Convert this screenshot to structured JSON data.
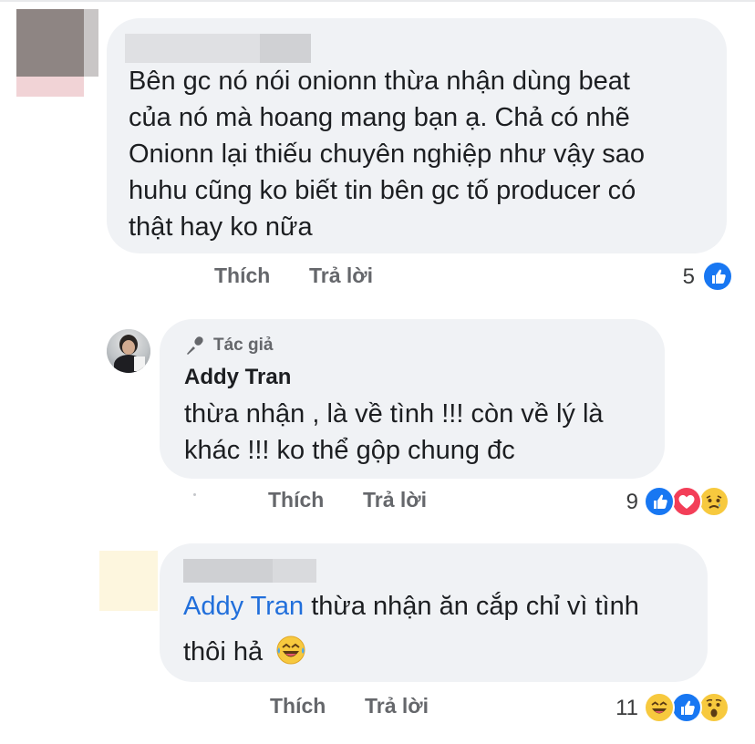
{
  "comments": [
    {
      "text_lines": [
        "Bên gc nó nói onionn thừa nhận dùng beat",
        "của nó mà hoang mang bạn ạ. Chả có nhẽ",
        "Onionn lại thiếu chuyên nghiệp như vậy sao",
        "huhu cũng ko biết tin bên gc tố producer có",
        "thật hay ko nữa"
      ],
      "like_label": "Thích",
      "reply_label": "Trả lời",
      "reaction_count": "5",
      "reactions": [
        "like"
      ]
    },
    {
      "badge_label": "Tác giả",
      "author": "Addy Tran",
      "text_lines": [
        "thừa nhận , là về tình !!! còn về lý là",
        "khác !!! ko thể gộp chung đc"
      ],
      "like_label": "Thích",
      "reply_label": "Trả lời",
      "reaction_count": "9",
      "reactions": [
        "like",
        "love",
        "sad"
      ]
    },
    {
      "mention": "Addy Tran",
      "text_line1_rest": " thừa nhận ăn cắp chỉ vì tình",
      "text_line2": "thôi hả",
      "emoji": "laughing-with-tears",
      "like_label": "Thích",
      "reply_label": "Trả lời",
      "reaction_count": "11",
      "reactions": [
        "haha",
        "like",
        "wow"
      ]
    }
  ],
  "colors": {
    "bubble": "#f0f2f5",
    "text": "#1c1e21",
    "action": "#65676b",
    "mention": "#216fdb",
    "like": "#1877f2",
    "love": "#f33e58",
    "emoji_yellow": "#f7c93e"
  }
}
